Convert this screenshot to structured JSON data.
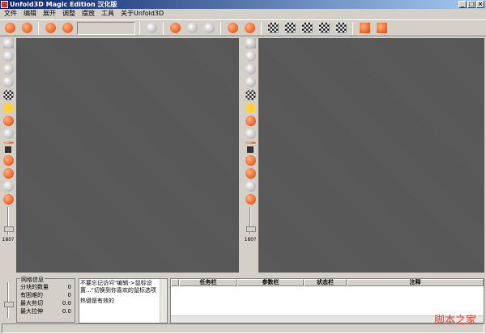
{
  "window": {
    "title": "Unfold3D Magic Edition 汉化版",
    "buttons": [
      "_",
      "□",
      "×"
    ]
  },
  "menu": [
    "文件",
    "编辑",
    "展开",
    "调整",
    "摆放",
    "工具",
    "关于Unfold3D"
  ],
  "left_slider_label": "180?",
  "mesh_info": {
    "title": "网格信息",
    "rows": [
      {
        "label": "分块的数量",
        "value": "0"
      },
      {
        "label": "有困难的",
        "value": "0"
      },
      {
        "label": "最大剪切",
        "value": "0.0"
      },
      {
        "label": "最大拉伸",
        "value": "0.0"
      }
    ]
  },
  "message": {
    "line1": "不要忘记访问\"编辑->鼠标设置...\"切换到你喜欢的鼠标选项",
    "line2": "热键是有效的"
  },
  "task_table": {
    "columns": [
      "任务栏",
      "参数栏",
      "状态栏",
      "注释"
    ]
  },
  "watermark": "脚本之家"
}
